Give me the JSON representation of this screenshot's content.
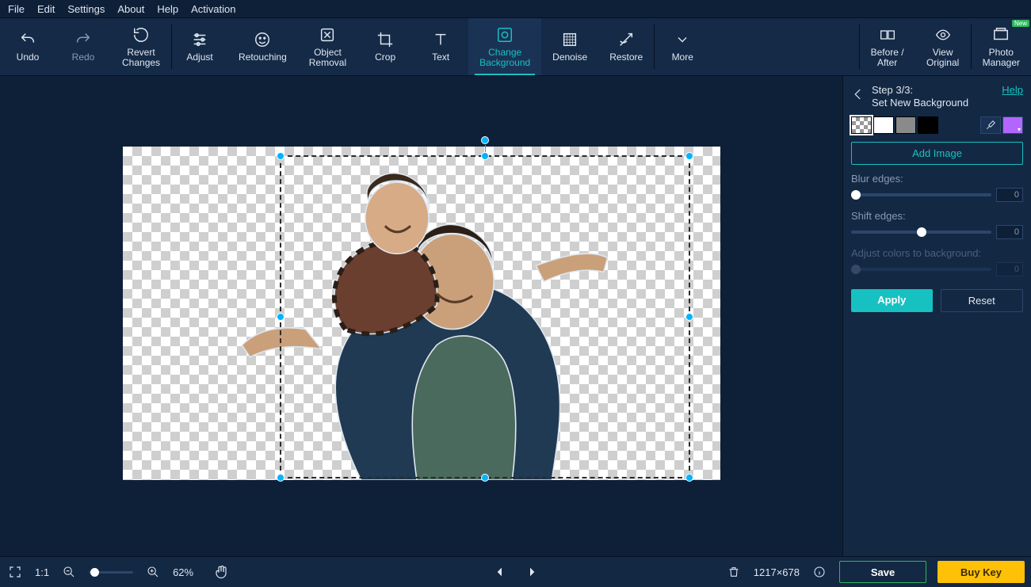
{
  "menu": [
    "File",
    "Edit",
    "Settings",
    "About",
    "Help",
    "Activation"
  ],
  "toolbar": {
    "undo": "Undo",
    "redo": "Redo",
    "revert": "Revert\nChanges",
    "adjust": "Adjust",
    "retouching": "Retouching",
    "object_removal": "Object\nRemoval",
    "crop": "Crop",
    "text": "Text",
    "change_bg": "Change\nBackground",
    "denoise": "Denoise",
    "restore": "Restore",
    "more": "More",
    "before_after": "Before /\nAfter",
    "view_original": "View\nOriginal",
    "photo_manager": "Photo\nManager",
    "new_badge": "New"
  },
  "panel": {
    "step": "Step 3/3:",
    "title": "Set New Background",
    "help": "Help",
    "add_image": "Add Image",
    "blur_label": "Blur edges:",
    "blur_value": "0",
    "shift_label": "Shift edges:",
    "shift_value": "0",
    "adjust_label": "Adjust colors to background:",
    "adjust_value": "0",
    "apply": "Apply",
    "reset": "Reset",
    "picker_color": "#b266ff"
  },
  "bottom": {
    "fit_label": "1:1",
    "zoom": "62%",
    "dimensions": "1217×678",
    "save": "Save",
    "buy": "Buy Key"
  }
}
